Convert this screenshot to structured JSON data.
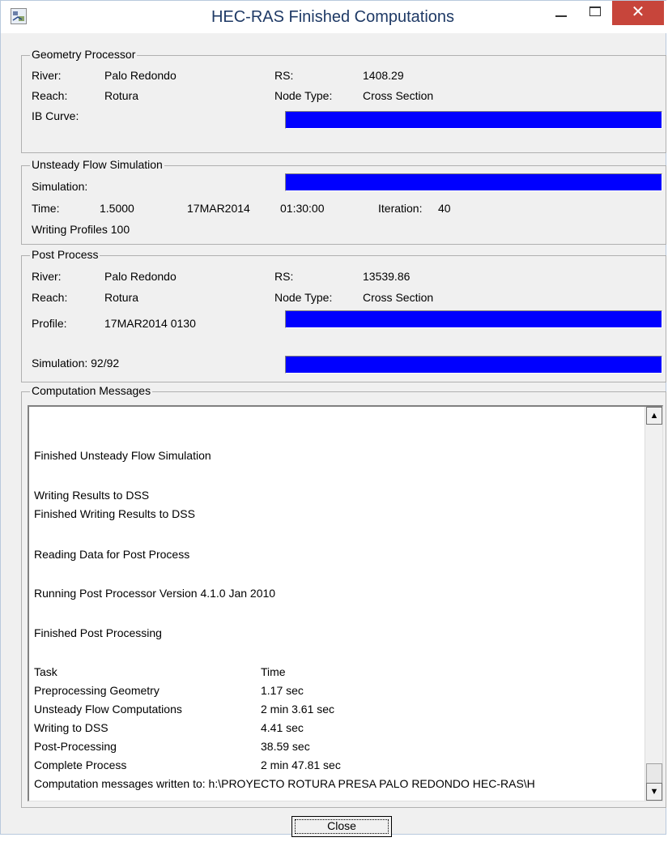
{
  "window": {
    "title": "HEC-RAS Finished Computations",
    "close_glyph": "✕"
  },
  "geometry": {
    "legend": "Geometry Processor",
    "river_label": "River:",
    "river_value": "Palo Redondo",
    "reach_label": "Reach:",
    "reach_value": "Rotura",
    "rs_label": "RS:",
    "rs_value": "1408.29",
    "nodetype_label": "Node Type:",
    "nodetype_value": "Cross Section",
    "ibcurve_label": "IB Curve:",
    "ibcurve_progress": 1.0
  },
  "unsteady": {
    "legend": "Unsteady Flow Simulation",
    "simulation_label": "Simulation:",
    "simulation_progress": 1.0,
    "time_label": "Time:",
    "time_value": "1.5000",
    "date_value": "17MAR2014",
    "clock_value": "01:30:00",
    "iteration_label": "Iteration:",
    "iteration_value": "40",
    "writing_profiles": "Writing Profiles 100"
  },
  "post": {
    "legend": "Post Process",
    "river_label": "River:",
    "river_value": "Palo Redondo",
    "reach_label": "Reach:",
    "reach_value": "Rotura",
    "rs_label": "RS:",
    "rs_value": "13539.86",
    "nodetype_label": "Node Type:",
    "nodetype_value": "Cross Section",
    "profile_label": "Profile:",
    "profile_value": "17MAR2014 0130",
    "profile_progress": 1.0,
    "simulation_label": "Simulation: 92/92",
    "simulation_progress": 1.0
  },
  "messages": {
    "legend": "Computation Messages",
    "lines": {
      "l0": "Finished Unsteady Flow Simulation",
      "l1": "Writing Results to DSS",
      "l2": "Finished Writing Results to DSS",
      "l3": "Reading Data for Post Process",
      "l4": "Running Post Processor  Version 4.1.0 Jan 2010",
      "l5": "Finished Post Processing"
    },
    "table": [
      {
        "task": "Task",
        "time": "Time"
      },
      {
        "task": "Preprocessing Geometry",
        "time": "1.17 sec"
      },
      {
        "task": "Unsteady Flow Computations",
        "time": "2 min 3.61 sec"
      },
      {
        "task": "Writing to DSS",
        "time": "4.41 sec"
      },
      {
        "task": "Post-Processing",
        "time": "38.59 sec"
      },
      {
        "task": "Complete Process",
        "time": "2 min 47.81 sec"
      }
    ],
    "last_line": "Computation messages written to: h:\\PROYECTO ROTURA PRESA PALO REDONDO HEC-RAS\\H",
    "scroll_up": "▲",
    "scroll_down": "▼"
  },
  "buttons": {
    "close": "Close"
  },
  "colors": {
    "progress": "#0000ff",
    "title_text": "#1f3a66",
    "close_button": "#c7453b"
  },
  "icons": [
    "hec-ras-app-icon",
    "minimize-icon",
    "maximize-icon",
    "close-icon",
    "scroll-up-arrow-icon",
    "scroll-down-arrow-icon"
  ]
}
